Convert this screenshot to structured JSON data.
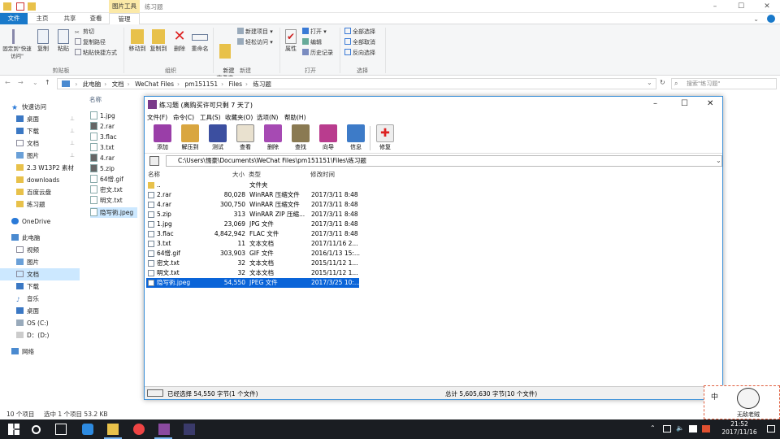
{
  "explorer": {
    "title": "练习题",
    "context_tab": "图片工具",
    "tabs": [
      "文件",
      "主页",
      "共享",
      "查看",
      "管理"
    ],
    "ribbon": {
      "clipboard": {
        "pin": "固定到\"快速访问\"",
        "copy": "复制",
        "paste": "粘贴",
        "cut": "剪切",
        "copy_path": "复制路径",
        "paste_shortcut": "粘贴快捷方式",
        "label": "剪贴板"
      },
      "organize": {
        "move_to": "移动到",
        "copy_to": "复制到",
        "delete": "删除",
        "rename": "重命名",
        "label": "组织"
      },
      "new": {
        "new_folder": "新建\n文件夹",
        "new_item": "新建项目 ▾",
        "easy_access": "轻松访问 ▾",
        "label": "新建"
      },
      "open": {
        "properties": "属性",
        "open": "打开 ▾",
        "edit": "编辑",
        "history": "历史记录",
        "label": "打开"
      },
      "select": {
        "select_all": "全部选择",
        "select_none": "全部取消",
        "invert": "反向选择",
        "label": "选择"
      }
    },
    "breadcrumbs": [
      "此电脑",
      "文档",
      "WeChat Files",
      "pm151151",
      "Files",
      "练习题"
    ],
    "search_placeholder": "搜索\"练习题\"",
    "nav": {
      "quick_access": "快速访问",
      "quick_items": [
        "桌面",
        "下载",
        "文档",
        "图片",
        "2.3 W13P2 素材",
        "downloads",
        "百度云盘",
        "练习题"
      ],
      "onedrive": "OneDrive",
      "this_pc": "此电脑",
      "pc_items": [
        "视频",
        "图片",
        "文档",
        "下载",
        "音乐",
        "桌面",
        "OS (C:)",
        "D：(D:)"
      ],
      "network": "网络"
    },
    "column_name": "名称",
    "files": [
      "1.jpg",
      "2.rar",
      "3.flac",
      "3.txt",
      "4.rar",
      "5.zip",
      "64憎.gif",
      "密文.txt",
      "明文.txt",
      "隐写術.jpeg"
    ],
    "status": {
      "count": "10 个项目",
      "selected": "选中 1 个项目  53.2 KB"
    }
  },
  "winrar": {
    "title": "练习题 (离购买许可只剩 7 天了)",
    "menus": [
      "文件(F)",
      "命令(C)",
      "工具(S)",
      "收藏夹(O)",
      "选项(N)",
      "帮助(H)"
    ],
    "tools": [
      "添加",
      "解压到",
      "测试",
      "查看",
      "删除",
      "查找",
      "向导",
      "信息",
      "修复"
    ],
    "path": "C:\\Users\\懦豪\\Documents\\WeChat Files\\pm151151\\Files\\练习题",
    "headers": {
      "name": "名称",
      "size": "大小",
      "type": "类型",
      "modified": "修改时间"
    },
    "rows": [
      {
        "name": "..",
        "size": "",
        "type": "文件夹",
        "date": ""
      },
      {
        "name": "2.rar",
        "size": "80,028",
        "type": "WinRAR 压缩文件",
        "date": "2017/3/11 8:48"
      },
      {
        "name": "4.rar",
        "size": "300,750",
        "type": "WinRAR 压缩文件",
        "date": "2017/3/11 8:48"
      },
      {
        "name": "5.zip",
        "size": "313",
        "type": "WinRAR ZIP 压缩...",
        "date": "2017/3/11 8:48"
      },
      {
        "name": "1.jpg",
        "size": "23,069",
        "type": "JPG 文件",
        "date": "2017/3/11 8:48"
      },
      {
        "name": "3.flac",
        "size": "4,842,942",
        "type": "FLAC 文件",
        "date": "2017/3/11 8:48"
      },
      {
        "name": "3.txt",
        "size": "11",
        "type": "文本文档",
        "date": "2017/11/16 2..."
      },
      {
        "name": "64憎.gif",
        "size": "303,903",
        "type": "GIF 文件",
        "date": "2016/1/13 15:..."
      },
      {
        "name": "密文.txt",
        "size": "32",
        "type": "文本文档",
        "date": "2015/11/12 1..."
      },
      {
        "name": "明文.txt",
        "size": "32",
        "type": "文本文档",
        "date": "2015/11/12 1..."
      },
      {
        "name": "隐写術.jpeg",
        "size": "54,550",
        "type": "JPEG 文件",
        "date": "2017/3/25 10:..."
      }
    ],
    "status_left": "已经选择 54,550 字节(1 个文件)",
    "status_right": "总计 5,605,630 字节(10 个文件)"
  },
  "taskbar": {
    "time": "21:52",
    "date": "2017/11/16"
  },
  "ime": {
    "lang": "中",
    "label": "无敌老贼"
  }
}
